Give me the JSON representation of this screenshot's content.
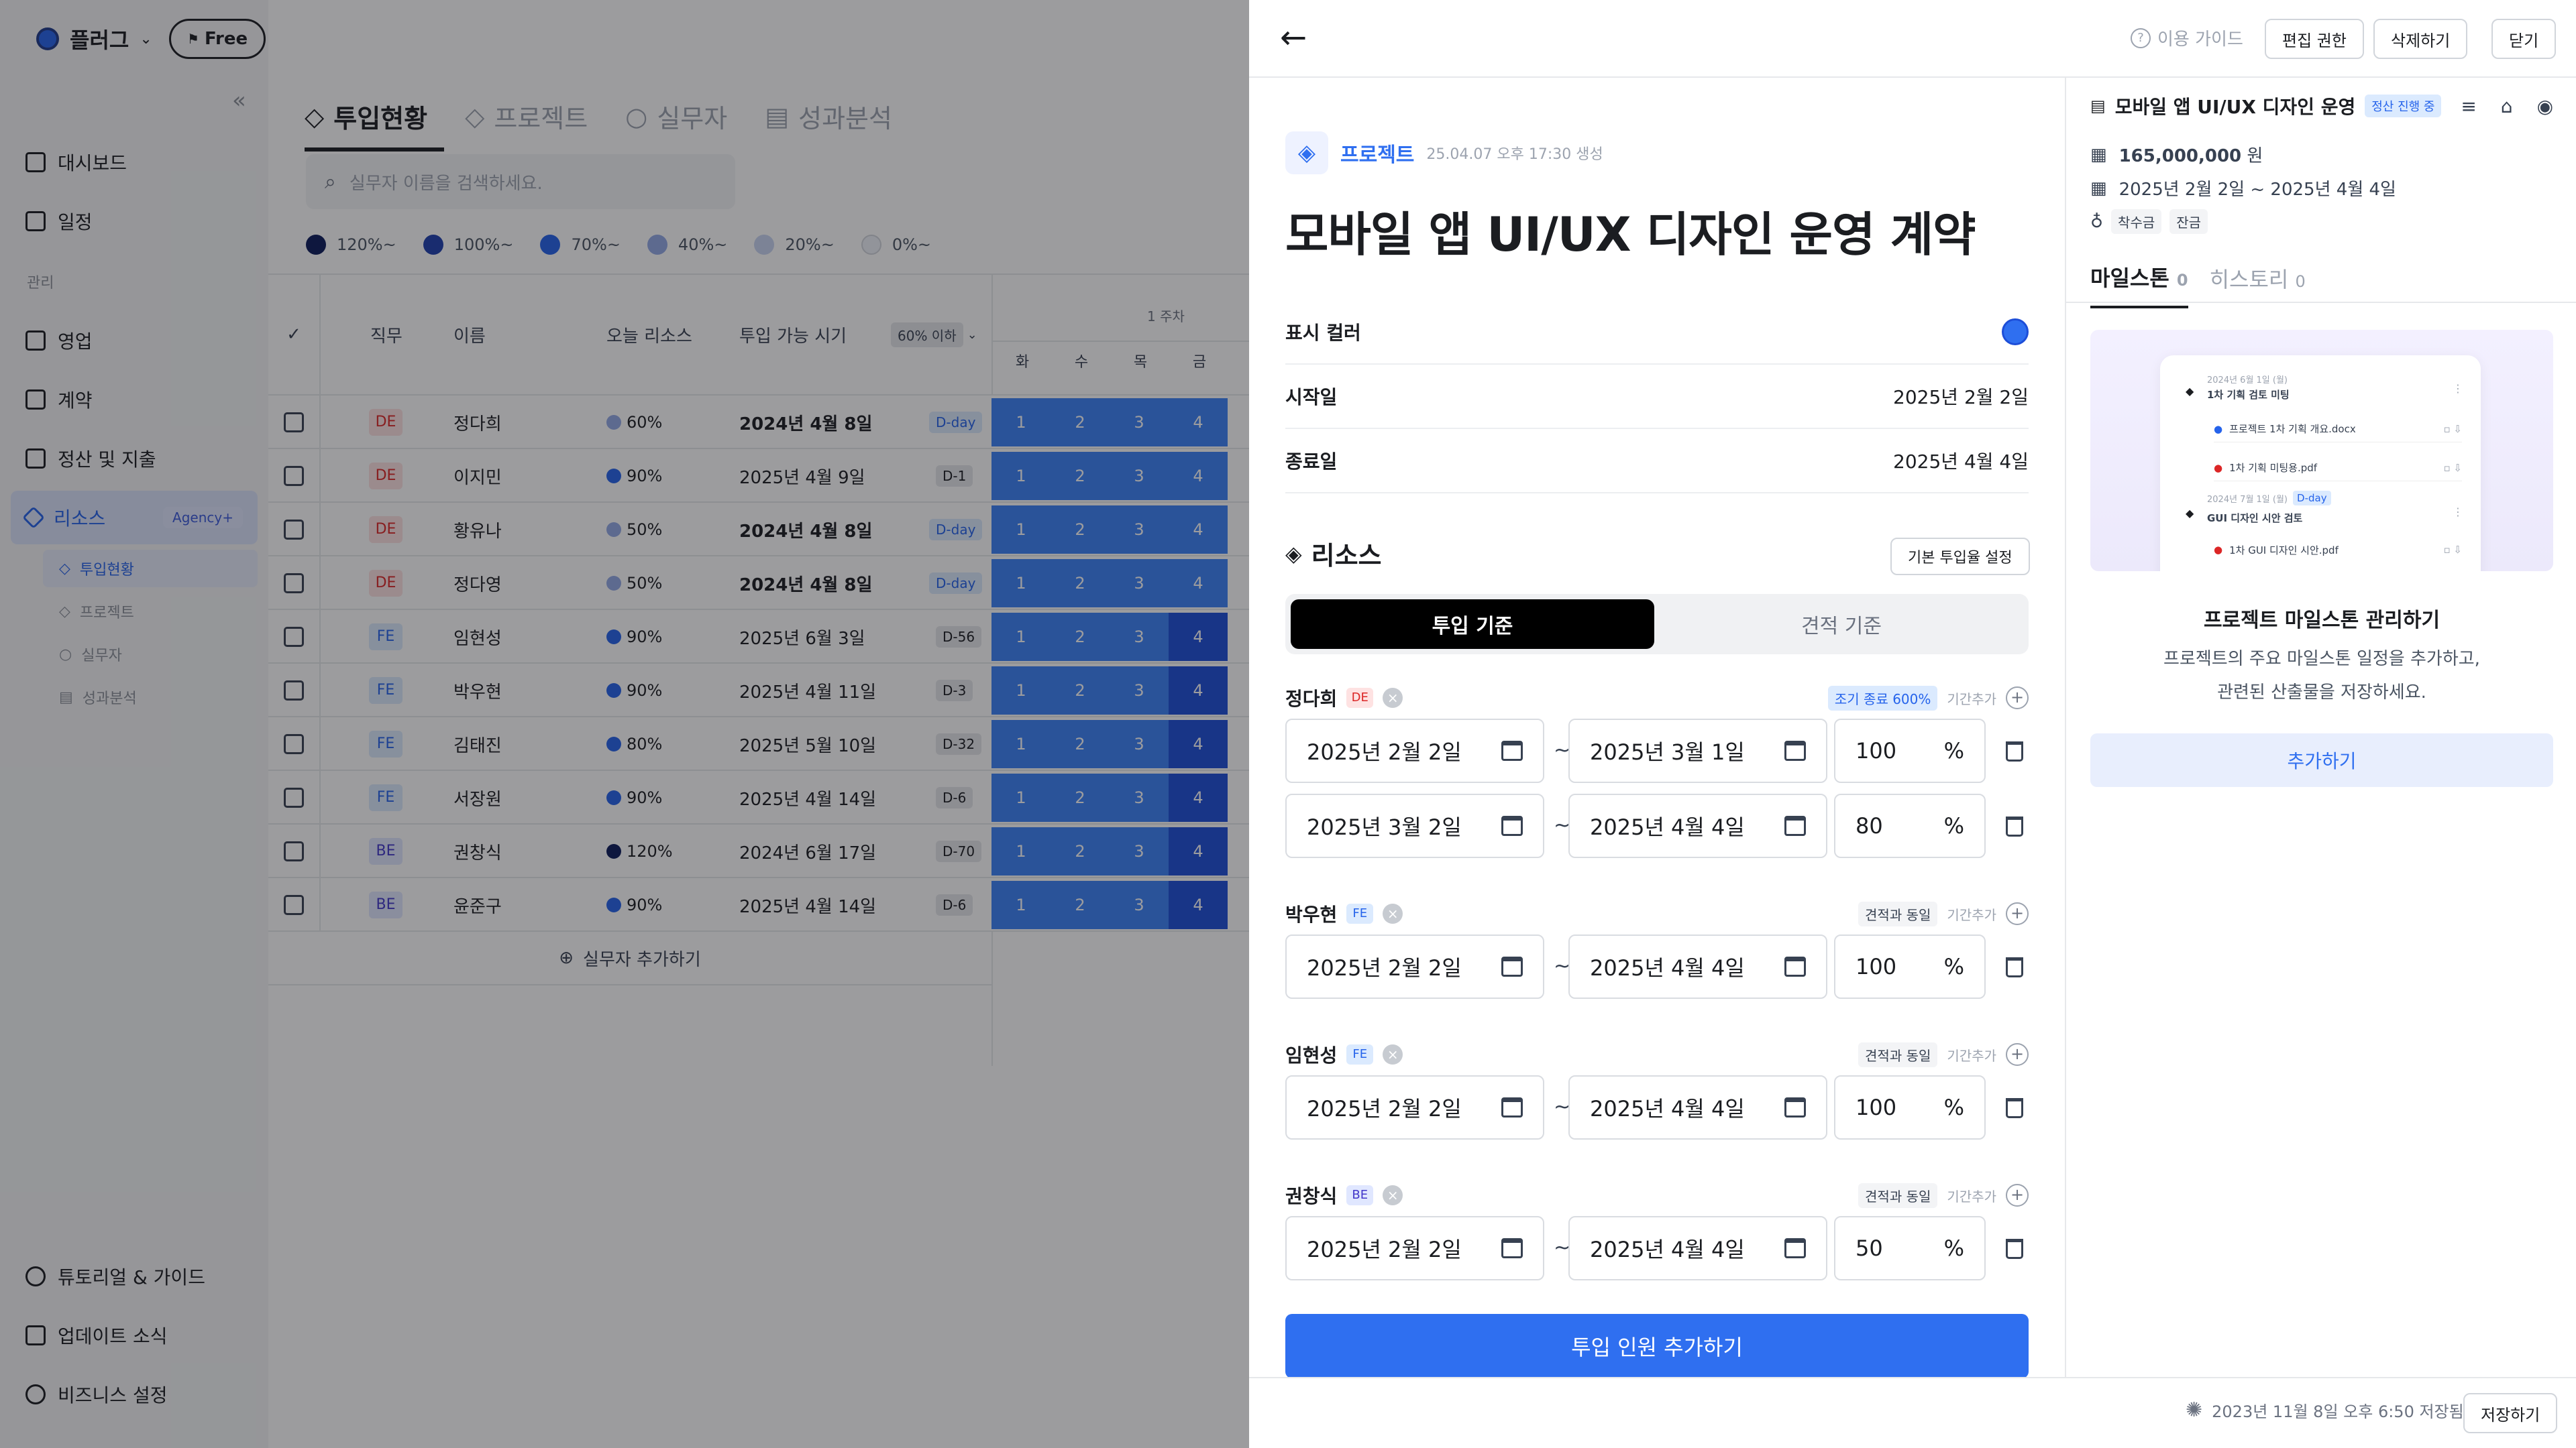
{
  "app": {
    "workspace": "플러그",
    "plan_badge": "Free",
    "collapse_icon": "double-chevron-left-icon"
  },
  "sidebar": {
    "items_top": [
      {
        "label": "대시보드",
        "icon": "chart-icon"
      },
      {
        "label": "일정",
        "icon": "calendar-icon"
      }
    ],
    "section_label": "관리",
    "items_manage": [
      {
        "label": "영업",
        "icon": "briefcase-icon"
      },
      {
        "label": "계약",
        "icon": "document-icon"
      },
      {
        "label": "정산 및 지출",
        "icon": "moneybag-icon"
      },
      {
        "label": "리소스",
        "icon": "resource-icon",
        "badge": "Agency+"
      }
    ],
    "sub_items": [
      "투입현황",
      "프로젝트",
      "실무자",
      "성과분석"
    ],
    "items_bottom": [
      {
        "label": "튜토리얼 & 가이드",
        "icon": "info-icon"
      },
      {
        "label": "업데이트 소식",
        "icon": "bell-icon"
      },
      {
        "label": "비즈니스 설정",
        "icon": "gear-icon"
      }
    ]
  },
  "main": {
    "tabs": [
      "투입현황",
      "프로젝트",
      "실무자",
      "성과분석"
    ],
    "search_placeholder": "실무자 이름을 검색하세요.",
    "legend": [
      {
        "label": "120%~",
        "color": "#0b1b5a"
      },
      {
        "label": "100%~",
        "color": "#1e3fae"
      },
      {
        "label": "70%~",
        "color": "#2563eb"
      },
      {
        "label": "40%~",
        "color": "#93a9e6"
      },
      {
        "label": "20%~",
        "color": "#c9d4f2"
      },
      {
        "label": "0%~",
        "color": "#eef1f8"
      }
    ],
    "table": {
      "headers": [
        "직무",
        "이름",
        "오늘 리소스",
        "투입 가능 시기"
      ],
      "filter": "60% 이하",
      "week_label": "1 주차",
      "days": [
        "화",
        "수",
        "목",
        "금"
      ],
      "add_label": "실무자 추가하기",
      "rows": [
        {
          "role": "DE",
          "name": "정다희",
          "res": "60%",
          "date": "2024년 4월 8일",
          "dday": "D-day",
          "bold": true
        },
        {
          "role": "DE",
          "name": "이지민",
          "res": "90%",
          "date": "2025년 4월 9일",
          "dday": "D-1",
          "bold": false
        },
        {
          "role": "DE",
          "name": "황유나",
          "res": "50%",
          "date": "2024년 4월 8일",
          "dday": "D-day",
          "bold": true
        },
        {
          "role": "DE",
          "name": "정다영",
          "res": "50%",
          "date": "2024년 4월 8일",
          "dday": "D-day",
          "bold": true
        },
        {
          "role": "FE",
          "name": "임현성",
          "res": "90%",
          "date": "2025년 6월 3일",
          "dday": "D-56",
          "bold": false
        },
        {
          "role": "FE",
          "name": "박우현",
          "res": "90%",
          "date": "2025년 4월 11일",
          "dday": "D-3",
          "bold": false
        },
        {
          "role": "FE",
          "name": "김태진",
          "res": "80%",
          "date": "2025년 5월 10일",
          "dday": "D-32",
          "bold": false
        },
        {
          "role": "FE",
          "name": "서장원",
          "res": "90%",
          "date": "2025년 4월 14일",
          "dday": "D-6",
          "bold": false
        },
        {
          "role": "BE",
          "name": "권창식",
          "res": "120%",
          "date": "2024년 6월 17일",
          "dday": "D-70",
          "bold": false
        },
        {
          "role": "BE",
          "name": "윤준구",
          "res": "90%",
          "date": "2025년 4월 14일",
          "dday": "D-6",
          "bold": false
        }
      ]
    }
  },
  "panel": {
    "top": {
      "guide": "이용 가이드",
      "edit_permission": "편집 권한",
      "delete": "삭제하기",
      "close": "닫기"
    },
    "project_label": "프로젝트",
    "created": "25.04.07 오후 17:30 생성",
    "title": "모바일 앱 UI/UX 디자인 운영 계약",
    "fields": {
      "color_label": "표시 컬러",
      "color": "#2f6ff0",
      "start_label": "시작일",
      "start": "2025년 2월 2일",
      "end_label": "종료일",
      "end": "2025년 4월 4일"
    },
    "resource": {
      "title": "리소스",
      "default_btn": "기본 투입율 설정",
      "seg_on": "투입 기준",
      "seg_off": "견적 기준",
      "percent": "%",
      "add_period": "기간추가",
      "people": [
        {
          "name": "정다희",
          "role": "DE",
          "tag": "조기 종료 600%",
          "tag_type": "early",
          "periods": [
            {
              "start": "2025년 2월 2일",
              "end": "2025년 3월 1일",
              "pct": "100"
            },
            {
              "start": "2025년 3월 2일",
              "end": "2025년 4월 4일",
              "pct": "80"
            }
          ]
        },
        {
          "name": "박우현",
          "role": "FE",
          "tag": "견적과 동일",
          "tag_type": "period",
          "periods": [
            {
              "start": "2025년 2월 2일",
              "end": "2025년 4월 4일",
              "pct": "100"
            }
          ]
        },
        {
          "name": "임현성",
          "role": "FE",
          "tag": "견적과 동일",
          "tag_type": "period",
          "periods": [
            {
              "start": "2025년 2월 2일",
              "end": "2025년 4월 4일",
              "pct": "100"
            }
          ]
        },
        {
          "name": "권창식",
          "role": "BE",
          "tag": "견적과 동일",
          "tag_type": "period",
          "periods": [
            {
              "start": "2025년 2월 2일",
              "end": "2025년 4월 4일",
              "pct": "50"
            }
          ]
        }
      ],
      "add_member": "투입 인원 추가하기"
    },
    "side": {
      "title": "모바일 앱 UI/UX 디자인 운영",
      "status": "정산 진행 중",
      "amount": "165,000,000",
      "amount_unit": "원",
      "period": "2025년 2월 2일 ~ 2025년 4월 4일",
      "chips": [
        "착수금",
        "잔금"
      ],
      "tabs": [
        {
          "label": "마일스톤",
          "count": "0"
        },
        {
          "label": "히스토리",
          "count": "0"
        }
      ],
      "preview": {
        "m1_date": "2024년 6월 1일 (월)",
        "m1_title": "1차 기획 검토 미팅",
        "m1_file1": "프로젝트 1차 기획 개요.docx",
        "m1_file2": "1차 기획 미팅용.pdf",
        "m2_date": "2024년 7월 1일 (월)",
        "m2_dday": "D-day",
        "m2_title": "GUI 디자인 시안 검토",
        "m2_file1": "1차 GUI 디자인 시안.pdf"
      },
      "empty_title": "프로젝트 마일스톤 관리하기",
      "empty_desc1": "프로젝트의 주요 마일스톤 일정을 추가하고,",
      "empty_desc2": "관련된 산출물을 저장하세요.",
      "add_btn": "추가하기"
    },
    "bottom": {
      "saved": "2023년 11월 8일 오후 6:50 저장됨",
      "save_btn": "저장하기"
    }
  }
}
